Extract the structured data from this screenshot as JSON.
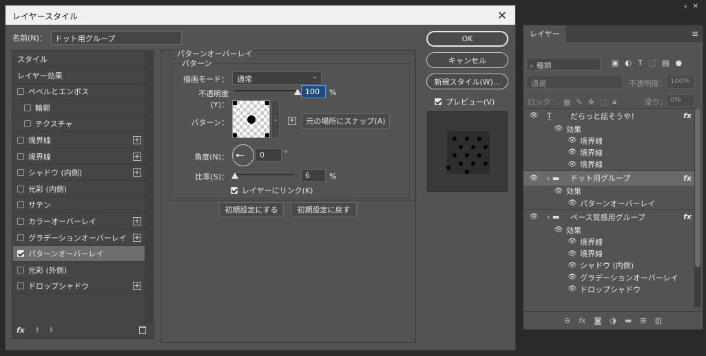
{
  "dialog": {
    "title": "レイヤースタイル",
    "close_icon": "✕",
    "name_label": "名前(N)：",
    "name_value": "ドット用グループ"
  },
  "styles_list": {
    "items": [
      {
        "label": "スタイル",
        "checkbox": false,
        "checked": false,
        "plus": false,
        "indent": false
      },
      {
        "label": "レイヤー効果",
        "checkbox": false,
        "checked": false,
        "plus": false,
        "indent": false
      },
      {
        "label": "ベベルとエンボス",
        "checkbox": true,
        "checked": false,
        "plus": false,
        "indent": false
      },
      {
        "label": "輪郭",
        "checkbox": true,
        "checked": false,
        "plus": false,
        "indent": true
      },
      {
        "label": "テクスチャ",
        "checkbox": true,
        "checked": false,
        "plus": false,
        "indent": true
      },
      {
        "label": "境界線",
        "checkbox": true,
        "checked": false,
        "plus": true,
        "indent": false
      },
      {
        "label": "境界線",
        "checkbox": true,
        "checked": false,
        "plus": true,
        "indent": false
      },
      {
        "label": "シャドウ (内側)",
        "checkbox": true,
        "checked": false,
        "plus": true,
        "indent": false
      },
      {
        "label": "光彩 (内側)",
        "checkbox": true,
        "checked": false,
        "plus": false,
        "indent": false
      },
      {
        "label": "サテン",
        "checkbox": true,
        "checked": false,
        "plus": false,
        "indent": false
      },
      {
        "label": "カラーオーバーレイ",
        "checkbox": true,
        "checked": false,
        "plus": true,
        "indent": false
      },
      {
        "label": "グラデーションオーバーレイ",
        "checkbox": true,
        "checked": false,
        "plus": true,
        "indent": false
      },
      {
        "label": "パターンオーバーレイ",
        "checkbox": true,
        "checked": true,
        "plus": false,
        "indent": false,
        "selected": true
      },
      {
        "label": "光彩 (外側)",
        "checkbox": true,
        "checked": false,
        "plus": false,
        "indent": false
      },
      {
        "label": "ドロップシャドウ",
        "checkbox": true,
        "checked": false,
        "plus": true,
        "indent": false
      }
    ],
    "footer": {
      "fx_icon": "fx",
      "up_icon": "⬆",
      "down_icon": "⬇",
      "trash_icon": "🗑"
    }
  },
  "pattern_overlay": {
    "title": "パターンオーバーレイ",
    "subtitle": "パターン",
    "blend_label": "描画モード：",
    "blend_value": "通常",
    "opacity_label": "不透明度(Y)：",
    "opacity_value": "100",
    "opacity_unit": "%",
    "opacity_fraction": 1.0,
    "pattern_label": "パターン：",
    "snap_label": "元の場所にスナップ(A)",
    "angle_label": "角度(N)：",
    "angle_value": "0",
    "angle_unit": "°",
    "scale_label": "比率(S)：",
    "scale_value": "6",
    "scale_unit": "%",
    "link_label": "レイヤーにリンク(K)",
    "link_checked": true,
    "reset_default_label": "初期設定にする",
    "restore_default_label": "初期設定に戻す"
  },
  "actions": {
    "ok": "OK",
    "cancel": "キャンセル",
    "new_style": "新規スタイル(W)...",
    "preview_label": "プレビュー(V)",
    "preview_checked": true
  },
  "layers_panel": {
    "tab": "レイヤー",
    "collapse_icon": "«",
    "close_icon": "✕",
    "menu_icon": "≡",
    "search_value": "種類",
    "blend_value": "通過",
    "opacity_label": "不透明度：",
    "opacity_value": "100%",
    "lock_label": "ロック：",
    "fill_label": "塗り：",
    "fill_value": "0%",
    "rows": [
      {
        "type": "layer",
        "icon": "text",
        "label": "だらっと話そうや！",
        "fx": true,
        "eye": true
      },
      {
        "type": "effect-head",
        "label": "効果"
      },
      {
        "type": "effect",
        "label": "境界線"
      },
      {
        "type": "effect",
        "label": "境界線"
      },
      {
        "type": "effect",
        "label": "境界線"
      },
      {
        "type": "layer",
        "icon": "folder",
        "label": "ドット用グループ",
        "fx": true,
        "eye": true,
        "selected": true
      },
      {
        "type": "effect-head",
        "label": "効果"
      },
      {
        "type": "effect",
        "label": "パターンオーバーレイ"
      },
      {
        "type": "layer",
        "icon": "folder",
        "label": "ベース質感用グループ",
        "fx": true,
        "eye": true
      },
      {
        "type": "effect-head",
        "label": "効果"
      },
      {
        "type": "effect",
        "label": "境界線"
      },
      {
        "type": "effect",
        "label": "境界線"
      },
      {
        "type": "effect",
        "label": "シャドウ (内側)"
      },
      {
        "type": "effect",
        "label": "グラデーションオーバーレイ"
      },
      {
        "type": "effect",
        "label": "ドロップシャドウ"
      }
    ],
    "footer_icons": [
      "link-icon",
      "fx-icon",
      "mask-icon",
      "adjustment-icon",
      "folder-icon",
      "new-layer-icon",
      "trash-icon"
    ]
  },
  "colors": {
    "accent": "#4da3ff",
    "panel": "#535353",
    "selection": "#6e6e6e"
  }
}
